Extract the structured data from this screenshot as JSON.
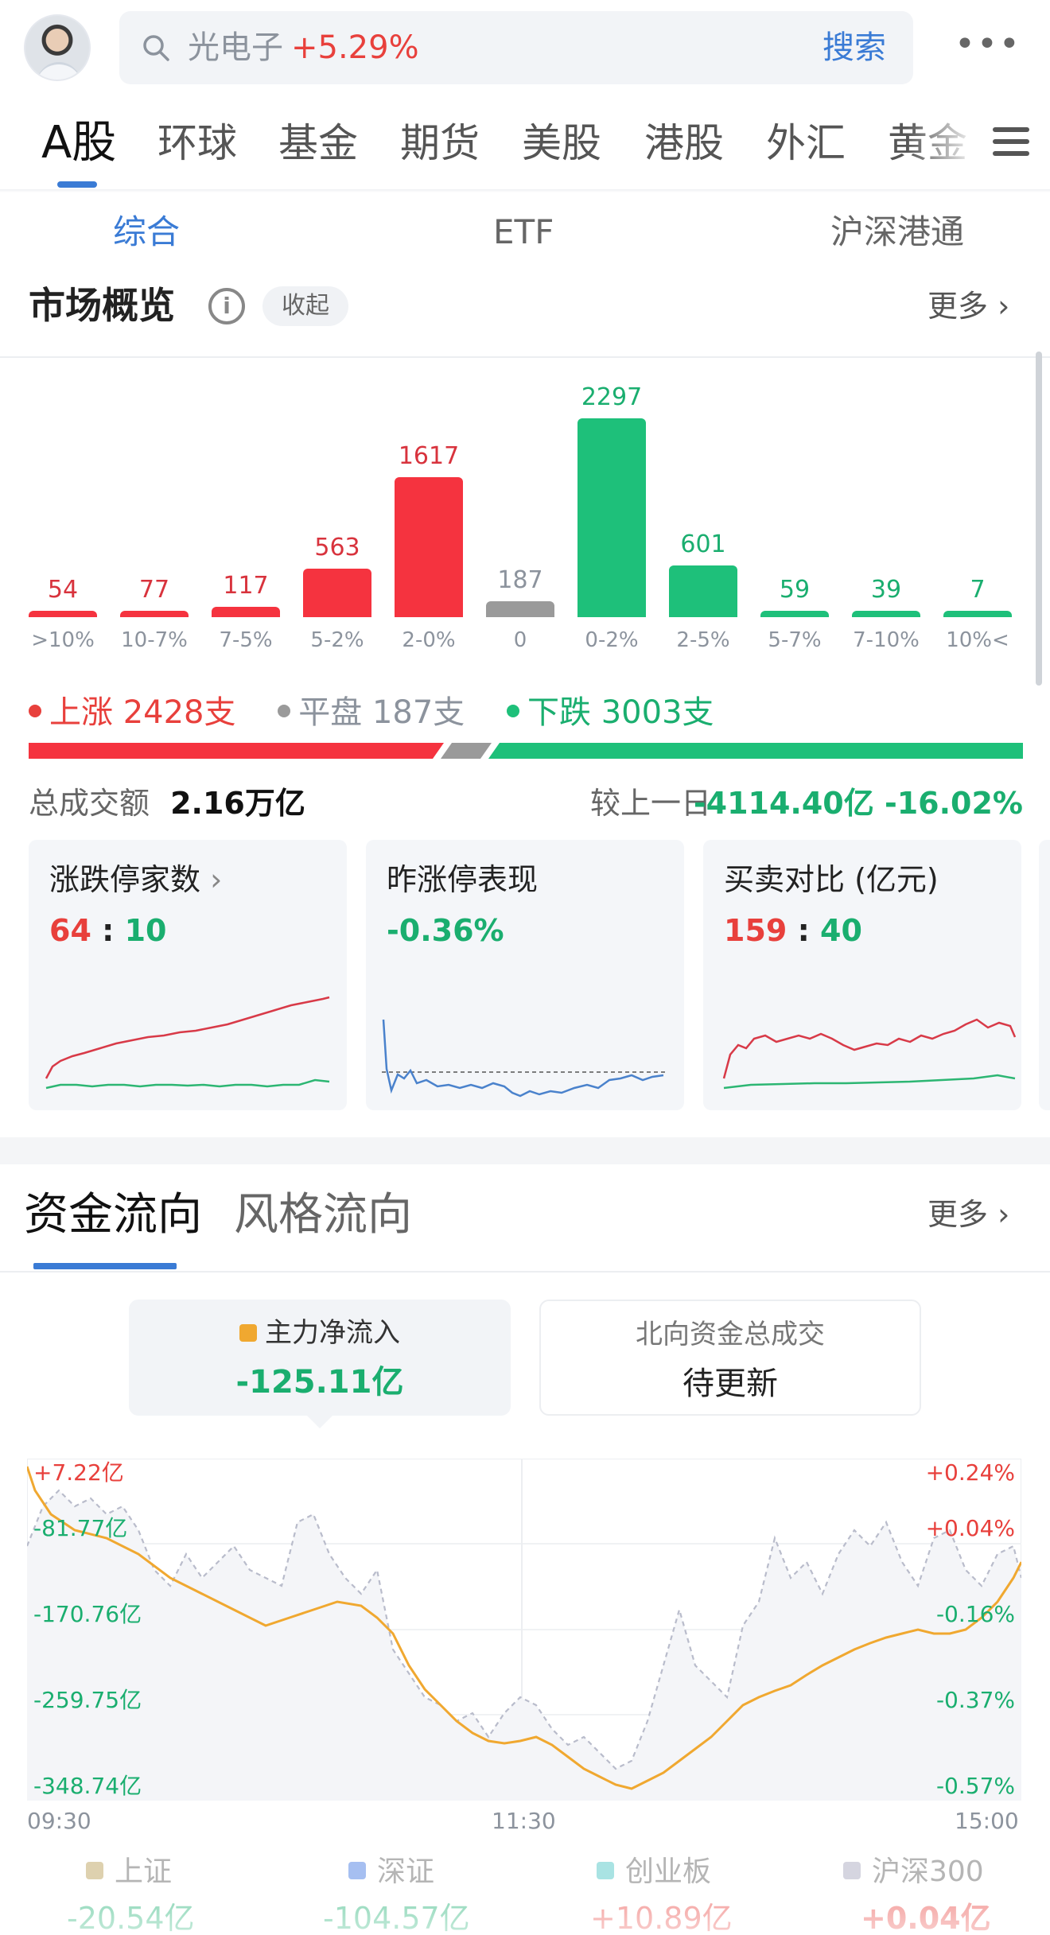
{
  "header": {
    "search_query": "光电子",
    "search_change": "+5.29%",
    "search_button": "搜索",
    "more_icon": "ellipsis-icon"
  },
  "main_tabs": [
    {
      "label": "A股",
      "active": true
    },
    {
      "label": "环球"
    },
    {
      "label": "基金"
    },
    {
      "label": "期货"
    },
    {
      "label": "美股"
    },
    {
      "label": "港股"
    },
    {
      "label": "外汇"
    },
    {
      "label": "黄金"
    }
  ],
  "sub_tabs": [
    {
      "label": "综合",
      "active": true
    },
    {
      "label": "ETF"
    },
    {
      "label": "沪深港通"
    }
  ],
  "market_overview": {
    "title": "市场概览",
    "collapse_label": "收起",
    "more_label": "更多",
    "legend": {
      "up": "上涨 2428支",
      "flat": "平盘 187支",
      "down": "下跌 3003支"
    },
    "turnover_label": "总成交额",
    "turnover_value": "2.16万亿",
    "compare_label": "较上一日",
    "compare_value": "-4114.40亿 -16.02%",
    "colors": {
      "up": "#f5333f",
      "flat": "#9a9a9a",
      "down": "#1ec07a"
    }
  },
  "chart_data": {
    "type": "bar",
    "categories": [
      ">10%",
      "10-7%",
      "7-5%",
      "5-2%",
      "2-0%",
      "0",
      "0-2%",
      "2-5%",
      "5-7%",
      "7-10%",
      "10%<"
    ],
    "values": [
      54,
      77,
      117,
      563,
      1617,
      187,
      2297,
      601,
      59,
      39,
      7
    ],
    "colors": [
      "up",
      "up",
      "up",
      "up",
      "up",
      "flat",
      "down",
      "down",
      "down",
      "down",
      "down"
    ],
    "ylim": [
      0,
      2297
    ]
  },
  "cards": [
    {
      "title": "涨跌停家数",
      "value_a": "64",
      "sep": ":",
      "value_b": "10",
      "chevron": "chevron-right-icon"
    },
    {
      "title": "昨涨停表现",
      "value": "-0.36%"
    },
    {
      "title": "买卖对比 (亿元)",
      "value_a": "159",
      "sep": ":",
      "value_b": "40"
    }
  ],
  "flow": {
    "tabs": [
      {
        "label": "资金流向",
        "active": true
      },
      {
        "label": "风格流向"
      }
    ],
    "more_label": "更多",
    "main_label": "主力净流入",
    "main_value": "-125.11亿",
    "north_label": "北向资金总成交",
    "north_value": "待更新",
    "y_left": [
      "+7.22亿",
      "-81.77亿",
      "-170.76亿",
      "-259.75亿",
      "-348.74亿"
    ],
    "y_right": [
      "+0.24%",
      "+0.04%",
      "-0.16%",
      "-0.37%",
      "-0.57%"
    ],
    "x_labels": [
      "09:30",
      "11:30",
      "15:00"
    ]
  },
  "indices": [
    {
      "name": "上证",
      "value": "-20.54亿",
      "color": "#c8b27a"
    },
    {
      "name": "深证",
      "value": "-104.57亿",
      "color": "#6b94e8"
    },
    {
      "name": "创业板",
      "value": "+10.89亿",
      "color": "#6fd0d0"
    },
    {
      "name": "沪深300",
      "value": "+0.04亿",
      "color": "#b9b9cc"
    }
  ]
}
